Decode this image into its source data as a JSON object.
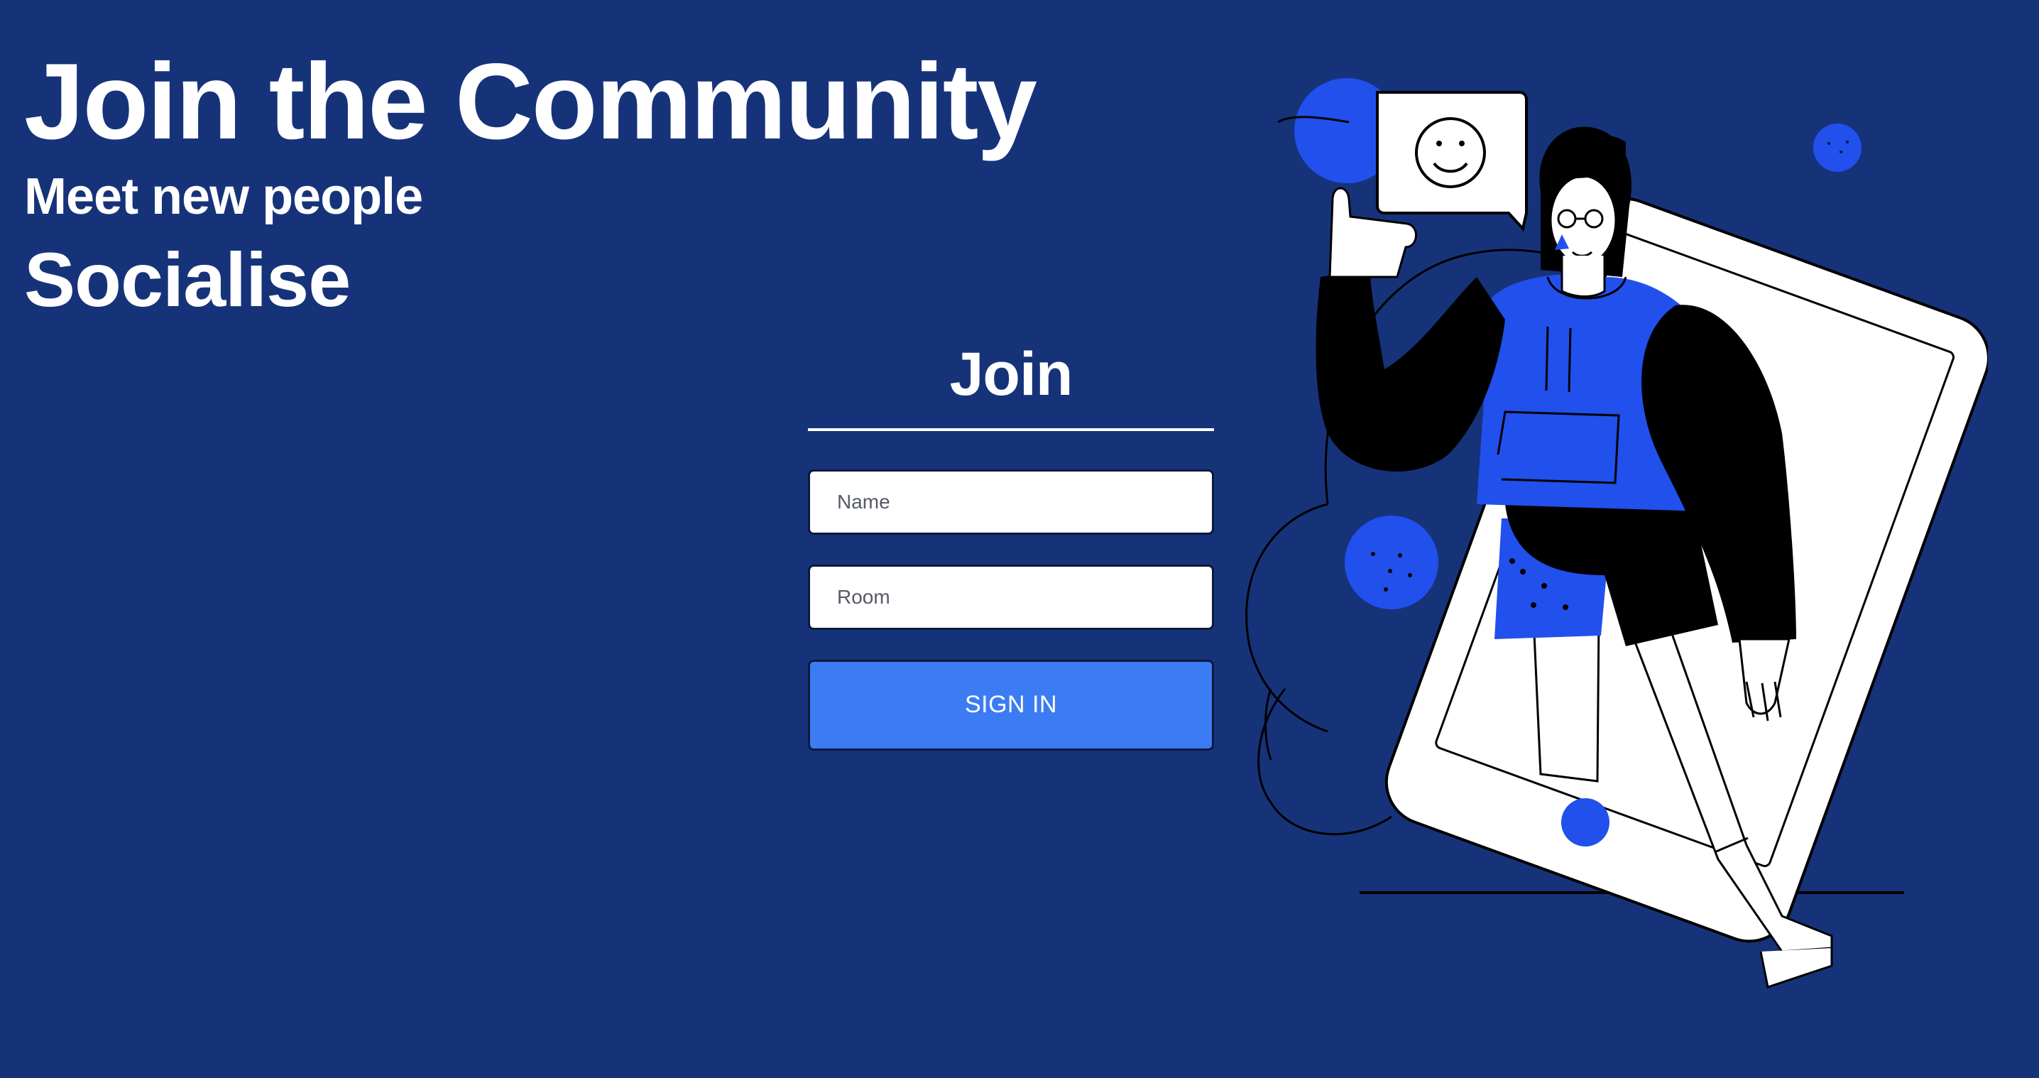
{
  "hero": {
    "title": "Join the Community",
    "subtitle": "Meet new people",
    "tagline": "Socialise"
  },
  "form": {
    "heading": "Join",
    "name_placeholder": "Name",
    "room_placeholder": "Room",
    "submit_label": "SIGN IN"
  },
  "colors": {
    "background": "#16337a",
    "button": "#3b7cf4",
    "accent_blue": "#2150ec",
    "text": "#ffffff"
  },
  "illustration": {
    "icon": "person-stepping-out-of-phone-illustration",
    "speech_bubble_icon": "smiley-face-icon"
  }
}
